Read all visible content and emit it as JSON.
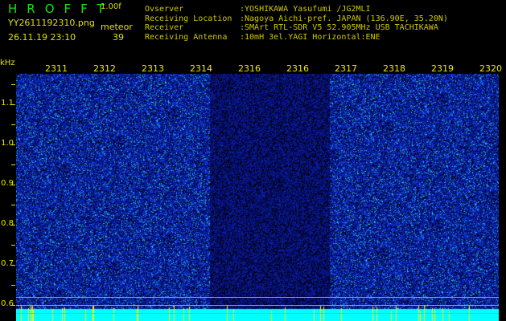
{
  "header": {
    "app_title": "HROFFT",
    "version": "1.00f",
    "filename": "YY2611192310.png",
    "mode": "meteor",
    "datetime": "26.11.19 23:10",
    "count": "39",
    "info": [
      {
        "key": "Ovserver",
        "value": ":YOSHIKAWA Yasufumi /JG2MLI"
      },
      {
        "key": "Receiving Location",
        "value": ":Nagoya Aichi-pref. JAPAN (136.90E, 35.20N)"
      },
      {
        "key": "Receiver",
        "value": ":SMArt RTL-SDR V5 52.905MHz USB TACHIKAWA"
      },
      {
        "key": "Receiving Antenna",
        "value": ":10mH 3el.YAGI Horizontal:ENE"
      }
    ]
  },
  "spectrogram": {
    "freq_unit": "kHz",
    "time_labels": [
      "2311",
      "2312",
      "2313",
      "2314",
      "2316",
      "2316",
      "2317",
      "2318",
      "2319",
      "2320"
    ],
    "freq_labels": [
      "1.1",
      "1.0",
      "0.9",
      "0.8",
      "0.7",
      "0.6"
    ],
    "colors": {
      "background": "#000000",
      "signal": "#1030e0",
      "peak": "#00ffff",
      "label": "#e8e800"
    }
  }
}
